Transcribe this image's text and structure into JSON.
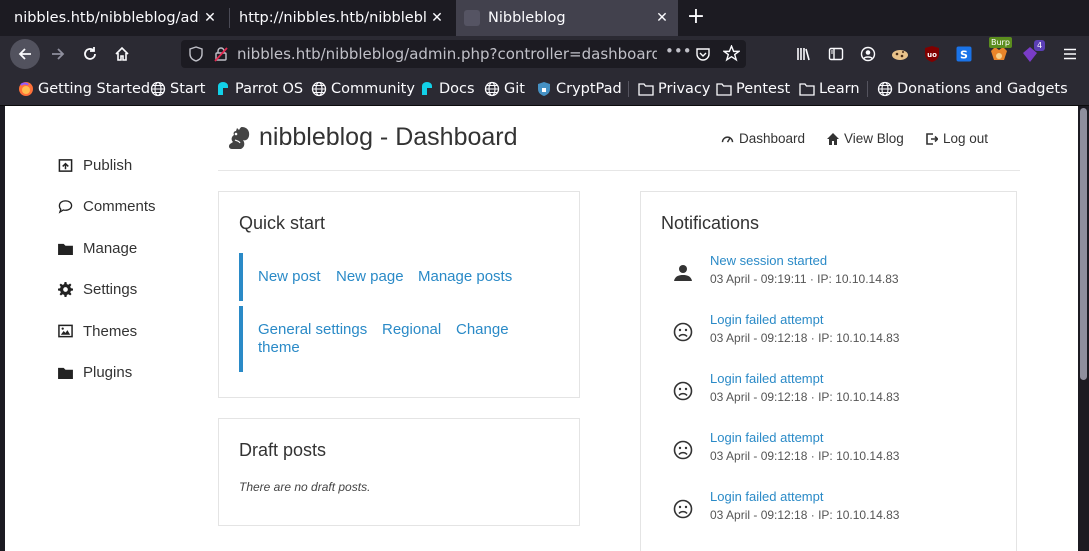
{
  "browser": {
    "tabs": [
      {
        "title": "nibbles.htb/nibbleblog/admin.php?controller=dashboard&action=view",
        "active": false
      },
      {
        "title": "http://nibbles.htb/nibbleblog/",
        "active": false
      },
      {
        "title": "Nibbleblog",
        "active": true
      }
    ],
    "url": "nibbles.htb/nibbleblog/admin.php?controller=dashboard&action=view",
    "extension_badges": {
      "burp": "Burp",
      "count": "4"
    },
    "bookmarks": [
      {
        "label": "Getting Started",
        "icon": "firefox-icon"
      },
      {
        "label": "Start",
        "icon": "globe-icon"
      },
      {
        "label": "Parrot OS",
        "icon": "parrot-icon"
      },
      {
        "label": "Community",
        "icon": "globe-icon"
      },
      {
        "label": "Docs",
        "icon": "parrot-icon"
      },
      {
        "label": "Git",
        "icon": "globe-icon"
      },
      {
        "label": "CryptPad",
        "icon": "shield-icon"
      },
      {
        "label": "Privacy",
        "icon": "folder-icon"
      },
      {
        "label": "Pentest",
        "icon": "folder-icon"
      },
      {
        "label": "Learn",
        "icon": "folder-icon"
      },
      {
        "label": "Donations and Gadgets",
        "icon": "globe-icon"
      }
    ]
  },
  "sidebar": {
    "items": [
      {
        "label": "Publish",
        "icon": "upload-icon"
      },
      {
        "label": "Comments",
        "icon": "comment-icon"
      },
      {
        "label": "Manage",
        "icon": "folder-icon"
      },
      {
        "label": "Settings",
        "icon": "gear-icon"
      },
      {
        "label": "Themes",
        "icon": "image-icon"
      },
      {
        "label": "Plugins",
        "icon": "folder-icon"
      }
    ]
  },
  "header": {
    "title": "nibbleblog - Dashboard",
    "links": [
      {
        "label": "Dashboard",
        "icon": "gauge-icon"
      },
      {
        "label": "View Blog",
        "icon": "home-icon"
      },
      {
        "label": "Log out",
        "icon": "logout-icon"
      }
    ]
  },
  "quick_start": {
    "title": "Quick start",
    "group1": [
      "New post",
      "New page",
      "Manage posts"
    ],
    "group2": [
      "General settings",
      "Regional",
      "Change",
      "theme"
    ]
  },
  "draft_posts": {
    "title": "Draft posts",
    "empty_text": "There are no draft posts."
  },
  "notifications": {
    "title": "Notifications",
    "items": [
      {
        "title": "New session started",
        "detail": "03 April - 09:19:11 · IP: 10.10.14.83",
        "icon": "user-icon"
      },
      {
        "title": "Login failed attempt",
        "detail": "03 April - 09:12:18 · IP: 10.10.14.83",
        "icon": "frown-icon"
      },
      {
        "title": "Login failed attempt",
        "detail": "03 April - 09:12:18 · IP: 10.10.14.83",
        "icon": "frown-icon"
      },
      {
        "title": "Login failed attempt",
        "detail": "03 April - 09:12:18 · IP: 10.10.14.83",
        "icon": "frown-icon"
      },
      {
        "title": "Login failed attempt",
        "detail": "03 April - 09:12:18 · IP: 10.10.14.83",
        "icon": "frown-icon"
      }
    ]
  },
  "colors": {
    "link": "#2a8ac7",
    "accent_bar": "#2a8ac7",
    "chrome_bg": "#1c1b22",
    "toolbar_bg": "#2b2a33"
  }
}
